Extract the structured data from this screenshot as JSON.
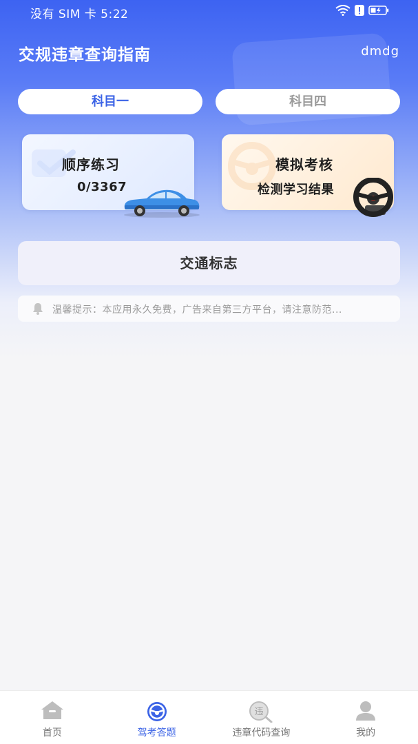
{
  "status_bar": {
    "text": "没有 SIM 卡 5:22",
    "icons": [
      "wifi-icon",
      "alert-icon",
      "battery-charging-icon"
    ]
  },
  "header": {
    "title": "交规违章查询指南",
    "username": "dmdg"
  },
  "tabs": [
    {
      "label": "科目一",
      "selected": true
    },
    {
      "label": "科目四",
      "selected": false
    }
  ],
  "cards": {
    "practice": {
      "title": "顺序练习",
      "progress": "0/3367",
      "icon": "car-icon"
    },
    "exam": {
      "title": "模拟考核",
      "subtitle": "检测学习结果",
      "icon": "steering-wheel-icon"
    }
  },
  "traffic_sign": {
    "label": "交通标志"
  },
  "notice": {
    "icon": "bell-icon",
    "text": "温馨提示：本应用永久免费，广告来自第三方平台，请注意防范..."
  },
  "bottom_nav": [
    {
      "label": "首页",
      "icon": "home-icon",
      "active": false
    },
    {
      "label": "驾考答题",
      "icon": "steering-wheel-icon",
      "active": true
    },
    {
      "label": "违章代码查询",
      "icon": "violation-search-icon",
      "active": false
    },
    {
      "label": "我的",
      "icon": "user-icon",
      "active": false
    }
  ],
  "colors": {
    "primary": "#3b63e6",
    "header_gradient_top": "#3d63f2",
    "background": "#f5f5f7"
  }
}
